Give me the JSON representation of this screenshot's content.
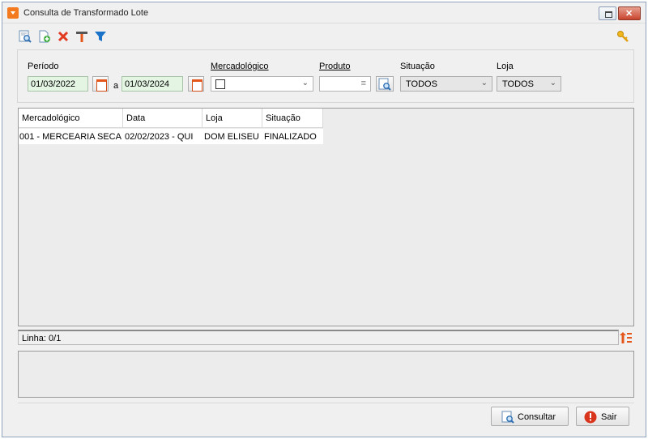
{
  "window": {
    "title": "Consulta de Transformado Lote"
  },
  "toolbar": {
    "icons": [
      "search-icon",
      "new-document-icon",
      "delete-icon",
      "tools-icon",
      "filter-icon",
      "key-icon"
    ]
  },
  "filters": {
    "periodo_label": "Período",
    "date_from": "01/03/2022",
    "date_sep": "a",
    "date_to": "01/03/2024",
    "mercadologico_label": "Mercadológico",
    "produto_label": "Produto",
    "situacao_label": "Situação",
    "situacao_value": "TODOS",
    "loja_label": "Loja",
    "loja_value": "TODOS"
  },
  "grid": {
    "columns": [
      "Mercadológico",
      "Data",
      "Loja",
      "Situação"
    ],
    "rows": [
      [
        "001 - MERCEARIA SECA",
        "02/02/2023 - QUI",
        "DOM ELISEU",
        "FINALIZADO"
      ]
    ]
  },
  "status": {
    "linha": "Linha: 0/1"
  },
  "buttons": {
    "consultar": "Consultar",
    "sair": "Sair"
  },
  "colors": {
    "accent_orange": "#f47a20",
    "date_field_bg": "#e4f5e4",
    "filter_blue": "#1a73c9",
    "delete_red": "#e23b1f",
    "exit_red": "#d9341c"
  }
}
